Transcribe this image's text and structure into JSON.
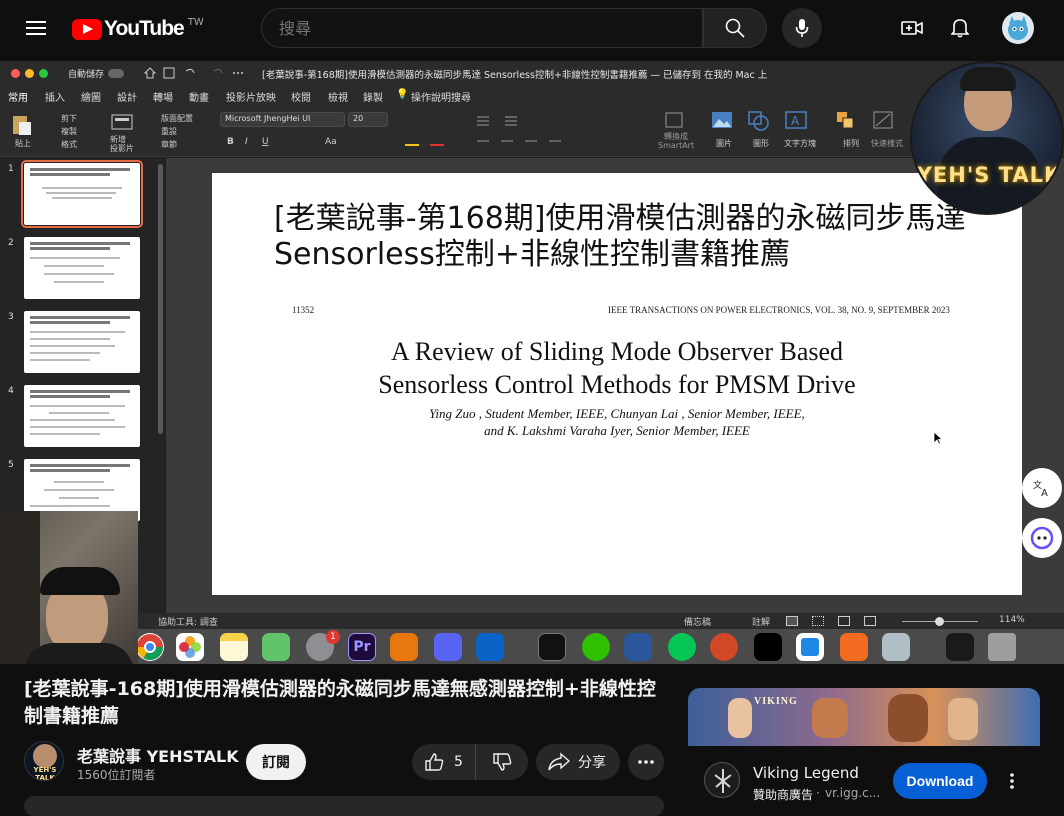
{
  "masthead": {
    "logo_text": "YouTube",
    "country_code": "TW",
    "search_placeholder": "搜尋"
  },
  "office": {
    "autosave_label": "自動儲存",
    "doc_title": "[老葉說事-第168期]使用滑模估測器的永磁同步馬達 Sensorless控制+非線性控制書籍推薦 — 已儲存到 在我的 Mac 上",
    "tabs": [
      "常用",
      "插入",
      "繪圖",
      "設計",
      "轉場",
      "動畫",
      "投影片放映",
      "校閱",
      "檢視",
      "錄製",
      "操作說明搜尋"
    ],
    "ribbon": {
      "paste": "貼上",
      "cut": "剪下",
      "copy": "複製",
      "format": "格式",
      "new_slide": "新增\n投影片",
      "layout": "版面配置",
      "reset": "重設",
      "section": "章節",
      "font_name": "Microsoft JhengHei UI",
      "font_size": "20",
      "convert_smartart": "轉換成\nSmartArt",
      "picture": "圖片",
      "shapes": "圖形",
      "textbox": "文字方塊",
      "arrange": "排列",
      "quick_styles": "快速樣式"
    },
    "thumb_numbers": [
      "1",
      "2",
      "3",
      "4",
      "5"
    ],
    "slide": {
      "title": "[老葉說事-第168期]使用滑模估測器的永磁同步馬達Sensorless控制+非線性控制書籍推薦",
      "page_no": "11352",
      "journal": "IEEE TRANSACTIONS ON POWER ELECTRONICS, VOL. 38, NO. 9, SEPTEMBER 2023",
      "paper_title_line1": "A Review of Sliding Mode Observer Based",
      "paper_title_line2": "Sensorless Control Methods for PMSM Drive",
      "authors_line1": "Ying Zuo , Student Member, IEEE, Chunyan Lai , Senior Member, IEEE,",
      "authors_line2": "and K. Lakshmi Varaha Iyer, Senior Member, IEEE"
    },
    "status": {
      "accessibility": "協助工具: 調查",
      "notes": "備忘稿",
      "comments": "註解",
      "zoom": "114%"
    }
  },
  "overlay": {
    "cam_logo": "YEH'S TALK",
    "dock_badge": "1",
    "dock_pr": "Pr"
  },
  "video": {
    "title": "[老葉說事-168期]使用滑模估測器的永磁同步馬達無感測器控制+非線性控制書籍推薦",
    "channel_name": "老葉說事 YEHSTALK",
    "channel_avatar_text": "YEH'S TALK",
    "subscribers": "1560位訂閱者",
    "subscribe_label": "訂閱",
    "like_count": "5",
    "share_label": "分享"
  },
  "ad": {
    "title": "Viking Legend",
    "sponsor": "贊助商廣告",
    "domain": "vr.igg.c...",
    "download_label": "Download",
    "banner_text": "VIKING"
  },
  "colors": {
    "bg": "#0f0f0f",
    "brand_red": "#ff0000",
    "download_blue": "#065fd4",
    "subscribe_bg": "#f1f1f1"
  }
}
